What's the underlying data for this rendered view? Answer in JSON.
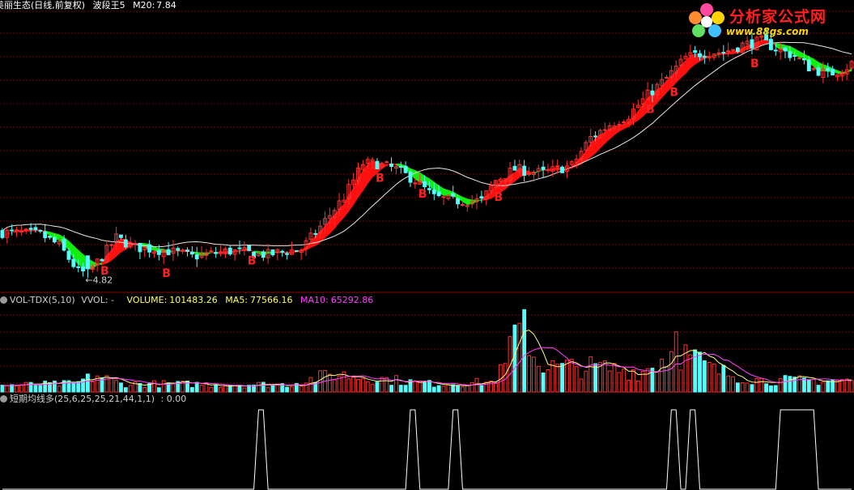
{
  "main_panel": {
    "stock_name": "美丽生态(日线,前复权)",
    "indicator_name": "波段王5",
    "ma20_label": "M20:",
    "ma20_value": "7.84",
    "low_annotation": "←4.82",
    "buy_marker": "B"
  },
  "volume_panel": {
    "indicator": "VOL-TDX(5,10)",
    "vvol": "VVOL: -",
    "volume_label": "VOLUME:",
    "volume_value": "101483.26",
    "ma5_label": "MA5:",
    "ma5_value": "77566.16",
    "ma10_label": "MA10:",
    "ma10_value": "65292.86"
  },
  "signal_panel": {
    "indicator": "短期均线多(25,6,25,25,21,44,1,1)",
    "value": ": 0.00"
  },
  "logo": {
    "title": "分析家公式网",
    "url": "www.88gs.com"
  },
  "colors": {
    "up": "#ff3030",
    "down": "#54fcfc",
    "band_up": "#ff1010",
    "band_down": "#10ee10",
    "ma_white": "#e8e8e8",
    "ma5": "#ffff80",
    "ma10": "#ff40ff",
    "grid": "#7a0000",
    "signal": "#ffffff",
    "marker": "#ff2020"
  },
  "chart_data": [
    {
      "type": "candlestick",
      "bars": 180,
      "ylim": [
        4.5,
        12.0
      ],
      "low_point": {
        "bar": 18,
        "price": 4.82
      },
      "price_path": [
        [
          0,
          6.05
        ],
        [
          8,
          6.0
        ],
        [
          12,
          5.7
        ],
        [
          16,
          5.0
        ],
        [
          18,
          4.95
        ],
        [
          21,
          5.4
        ],
        [
          24,
          5.9
        ],
        [
          28,
          5.65
        ],
        [
          35,
          5.55
        ],
        [
          40,
          5.4
        ],
        [
          48,
          5.55
        ],
        [
          56,
          5.45
        ],
        [
          60,
          5.55
        ],
        [
          63,
          5.6
        ],
        [
          67,
          6.2
        ],
        [
          72,
          7.0
        ],
        [
          76,
          7.9
        ],
        [
          79,
          7.9
        ],
        [
          83,
          7.75
        ],
        [
          87,
          7.45
        ],
        [
          91,
          7.0
        ],
        [
          95,
          6.9
        ],
        [
          101,
          6.9
        ],
        [
          104,
          7.45
        ],
        [
          108,
          7.75
        ],
        [
          114,
          7.65
        ],
        [
          120,
          7.85
        ],
        [
          124,
          8.6
        ],
        [
          128,
          8.95
        ],
        [
          132,
          9.2
        ],
        [
          136,
          9.75
        ],
        [
          140,
          10.2
        ],
        [
          144,
          10.75
        ],
        [
          148,
          10.9
        ],
        [
          152,
          10.9
        ],
        [
          156,
          11.1
        ],
        [
          160,
          11.2
        ],
        [
          164,
          10.95
        ],
        [
          167,
          10.8
        ],
        [
          170,
          10.5
        ],
        [
          174,
          10.3
        ],
        [
          178,
          10.5
        ],
        [
          179,
          10.6
        ]
      ],
      "buy_signal_bars": [
        21,
        34,
        52,
        79,
        88,
        104,
        136,
        141,
        158
      ]
    },
    {
      "type": "bar",
      "series": [
        "VOLUME",
        "MA5",
        "MA10"
      ],
      "volume_path": [
        [
          0,
          0.08
        ],
        [
          15,
          0.1
        ],
        [
          20,
          0.2
        ],
        [
          25,
          0.1
        ],
        [
          60,
          0.09
        ],
        [
          64,
          0.14
        ],
        [
          70,
          0.22
        ],
        [
          80,
          0.16
        ],
        [
          90,
          0.1
        ],
        [
          103,
          0.12
        ],
        [
          106,
          0.3
        ],
        [
          108,
          0.82
        ],
        [
          111,
          0.5
        ],
        [
          115,
          0.3
        ],
        [
          125,
          0.3
        ],
        [
          135,
          0.25
        ],
        [
          142,
          0.52
        ],
        [
          146,
          0.4
        ],
        [
          150,
          0.26
        ],
        [
          160,
          0.14
        ],
        [
          180,
          0.14
        ]
      ]
    },
    {
      "type": "line",
      "name": "短期均线多",
      "value": 0.0,
      "pulses": [
        {
          "from": 54,
          "to": 55
        },
        {
          "from": 86,
          "to": 87
        },
        {
          "from": 95,
          "to": 96
        },
        {
          "from": 141,
          "to": 142
        },
        {
          "from": 145,
          "to": 146
        },
        {
          "from": 164,
          "to": 171
        }
      ]
    }
  ]
}
